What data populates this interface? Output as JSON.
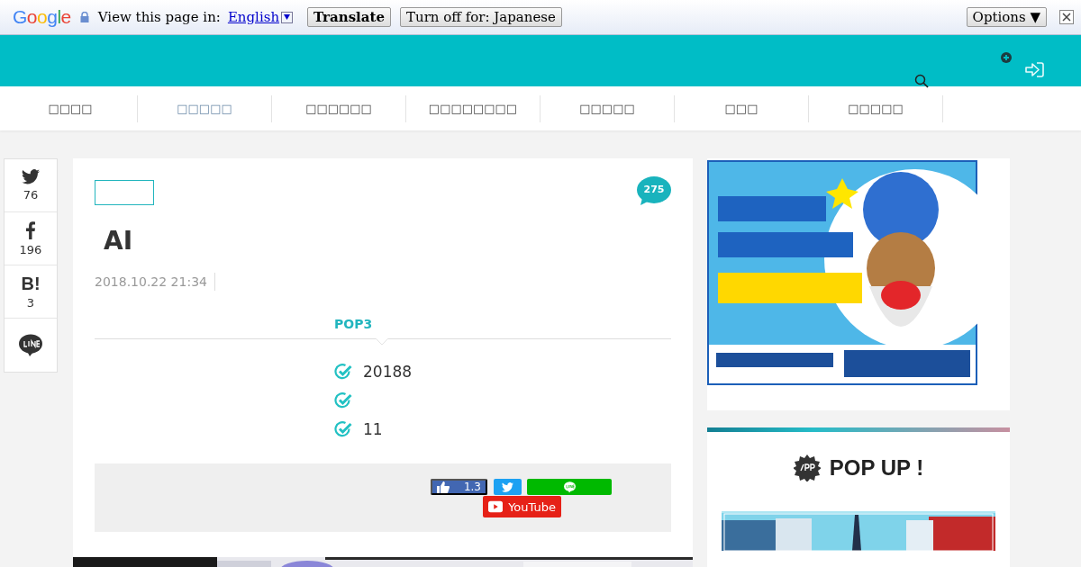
{
  "translate_bar": {
    "logo": "Google",
    "label": "View this page in:",
    "language": "English",
    "translate_button": "Translate",
    "turn_off_button": "Turn off for: Japanese",
    "options_button": "Options ▼"
  },
  "nav": {
    "items": [
      {
        "label": "□□□□",
        "selected": false
      },
      {
        "label": "□□□□□",
        "selected": true
      },
      {
        "label": "□□□□□□",
        "selected": false
      },
      {
        "label": "□□□□□□□□",
        "selected": false
      },
      {
        "label": "□□□□□",
        "selected": false
      },
      {
        "label": "□□□",
        "selected": false
      },
      {
        "label": "□□□□□",
        "selected": false
      }
    ]
  },
  "share_rail": [
    {
      "kind": "twitter",
      "count": "76"
    },
    {
      "kind": "facebook",
      "count": "196"
    },
    {
      "kind": "hatena",
      "label": "B!",
      "count": "3"
    },
    {
      "kind": "line"
    }
  ],
  "article": {
    "title": "AI",
    "date": "2018.10.22 21:34",
    "comment_count": "275",
    "toc": {
      "title": "POP3",
      "items": [
        {
          "kind": "text",
          "text": "20188"
        },
        {
          "kind": "icon_only"
        },
        {
          "kind": "text",
          "text": "11"
        }
      ]
    },
    "share_box": {
      "like_count": "1.3",
      "youtube_label": "YouTube"
    }
  },
  "sidebar": {
    "heading": "POP UP !"
  }
}
